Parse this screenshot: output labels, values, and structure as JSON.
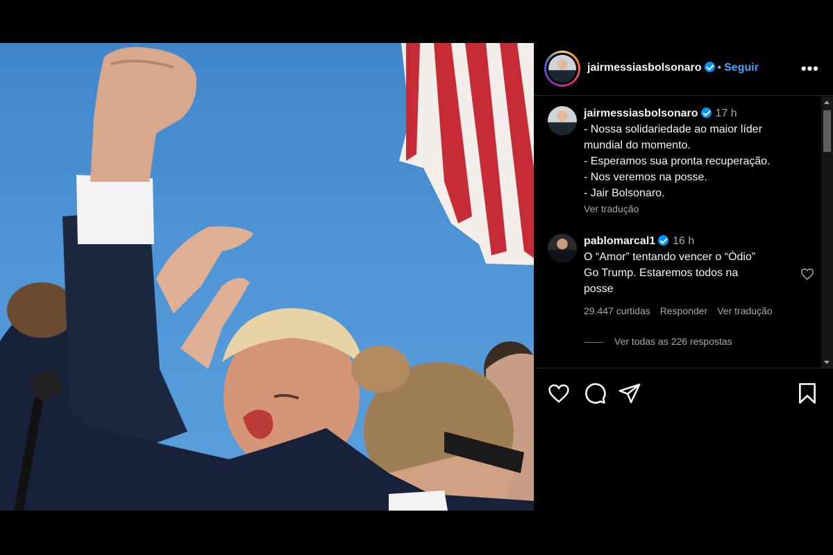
{
  "post": {
    "author": "jairmessiasbolsonaro",
    "follow_label": "Seguir",
    "separator": "•",
    "more_label": "•••"
  },
  "comments": [
    {
      "username": "jairmessiasbolsonaro",
      "time": "17 h",
      "lines": [
        "- Nossa solidariedade ao maior líder",
        "mundial do momento.",
        "- Esperamos sua pronta recuperação.",
        "- Nos veremos na posse.",
        "- Jair Bolsonaro."
      ],
      "translate_label": "Ver tradução"
    },
    {
      "username": "pablomarcal1",
      "time": "16 h",
      "lines": [
        "O “Amor” tentando vencer o “Ódio”",
        "Go Trump. Estaremos todos na",
        "posse"
      ],
      "likes": "29.447 curtidas",
      "reply_label": "Responder",
      "translate_label": "Ver tradução",
      "view_replies": "Ver todas as 226 respostas"
    }
  ],
  "actions": [
    "heart-icon",
    "comment-icon",
    "share-icon",
    "bookmark-icon"
  ],
  "colors": {
    "background": "#000000",
    "text": "#f5f5f5",
    "muted": "#a8a8a8",
    "link": "#3ea6ff",
    "verified": "#0095f6",
    "sky": "#4f95d6"
  }
}
